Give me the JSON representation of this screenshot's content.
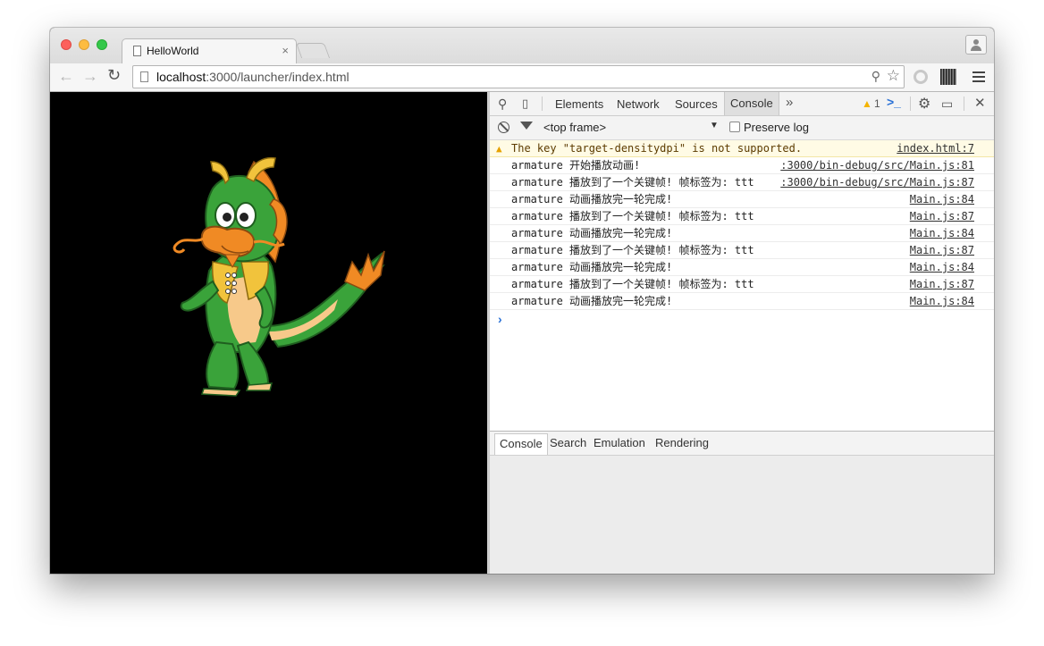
{
  "browser": {
    "tab_title": "HelloWorld",
    "tab_close": "×",
    "url_host": "localhost",
    "url_rest": ":3000/launcher/index.html"
  },
  "devtools": {
    "tabs": [
      "Elements",
      "Network",
      "Sources",
      "Console"
    ],
    "active_tab": "Console",
    "more": "»",
    "warning_count": "1",
    "frame_select": "<top frame>",
    "preserve_log": "Preserve log",
    "console_rows": [
      {
        "type": "warning",
        "message": "The key \"target-densitydpi\" is not supported.",
        "source": "index.html:7"
      },
      {
        "type": "log",
        "message": "armature 开始播放动画!",
        "source": ":3000/bin-debug/src/Main.js:81"
      },
      {
        "type": "log",
        "message": "armature 播放到了一个关键帧! 帧标签为: ttt",
        "source": ":3000/bin-debug/src/Main.js:87"
      },
      {
        "type": "log",
        "message": "armature 动画播放完一轮完成!",
        "source": "Main.js:84"
      },
      {
        "type": "log",
        "message": "armature 播放到了一个关键帧! 帧标签为: ttt",
        "source": "Main.js:87"
      },
      {
        "type": "log",
        "message": "armature 动画播放完一轮完成!",
        "source": "Main.js:84"
      },
      {
        "type": "log",
        "message": "armature 播放到了一个关键帧! 帧标签为: ttt",
        "source": "Main.js:87"
      },
      {
        "type": "log",
        "message": "armature 动画播放完一轮完成!",
        "source": "Main.js:84"
      },
      {
        "type": "log",
        "message": "armature 播放到了一个关键帧! 帧标签为: ttt",
        "source": "Main.js:87"
      },
      {
        "type": "log",
        "message": "armature 动画播放完一轮完成!",
        "source": "Main.js:84"
      }
    ],
    "drawer_tabs": [
      "Console",
      "Search",
      "Emulation",
      "Rendering"
    ]
  },
  "icons": {
    "back": "back-arrow-icon",
    "forward": "forward-arrow-icon",
    "reload": "reload-icon",
    "inspect": "magnifier-icon",
    "device": "device-mode-icon",
    "settings": "gear-icon",
    "dock": "dock-icon",
    "close": "close-icon"
  },
  "colors": {
    "warning_bg": "#fffbe5",
    "dragon_green": "#3aa33a",
    "dragon_orange": "#f08a24",
    "vest_yellow": "#f1c33c"
  }
}
